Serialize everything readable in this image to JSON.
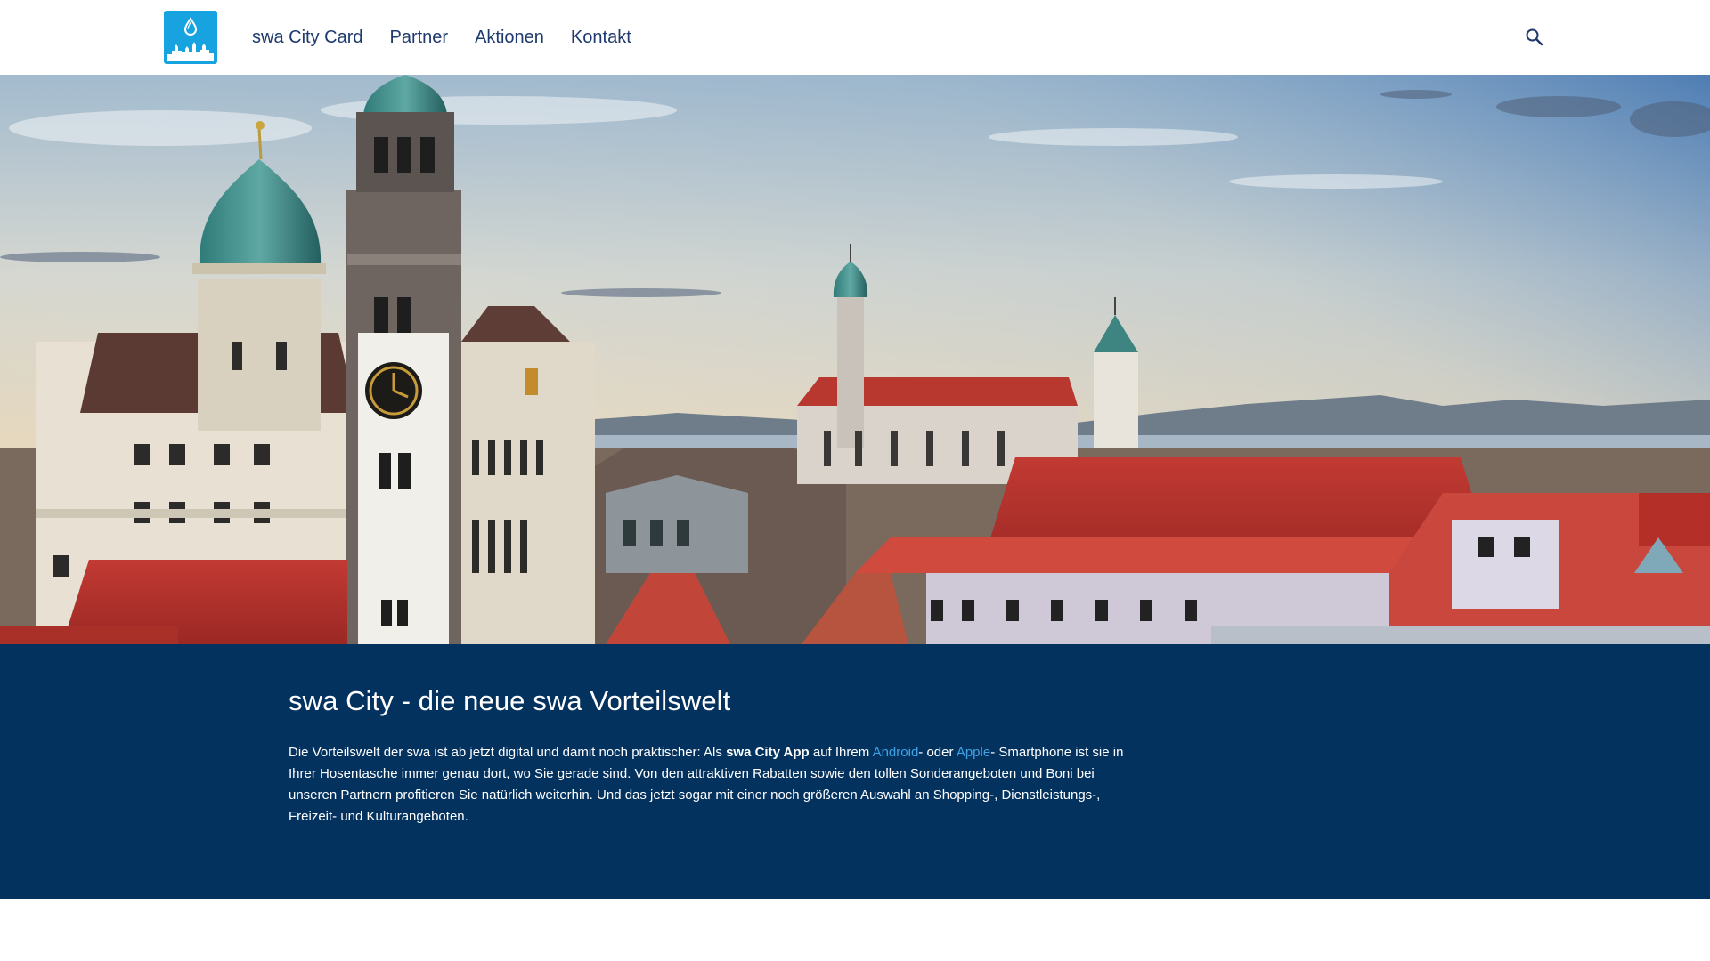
{
  "brand": {
    "logo_icon": "swa-city-skyline-drop-icon",
    "accent_color": "#17a3e0"
  },
  "nav": {
    "items": [
      {
        "label": "swa City Card"
      },
      {
        "label": "Partner"
      },
      {
        "label": "Aktionen"
      },
      {
        "label": "Kontakt"
      }
    ],
    "search_icon": "search-icon",
    "text_color": "#1e3a6e"
  },
  "hero": {
    "image_subject": "augsburg-city-skyline-image"
  },
  "intro": {
    "background_color": "#04325f",
    "link_color": "#3fa3e6",
    "title": "swa City - die neue swa Vorteilswelt",
    "text_part1": "Die Vorteilswelt der swa ist ab jetzt digital und damit noch praktischer: Als ",
    "text_bold": "swa City App",
    "text_part2": " auf Ihrem ",
    "link_android": "Android",
    "text_part3": "- oder ",
    "link_apple": "Apple",
    "text_part4": "- Smartphone ist sie in Ihrer Hosentasche immer genau dort, wo Sie gerade sind. Von den attraktiven Rabatten sowie den tollen Sonderangeboten und Boni bei unseren Partnern profitieren Sie natürlich weiterhin. Und das jetzt sogar mit einer noch größeren Auswahl an Shopping-, Dienstleistungs-, Freizeit- und Kulturangeboten."
  }
}
